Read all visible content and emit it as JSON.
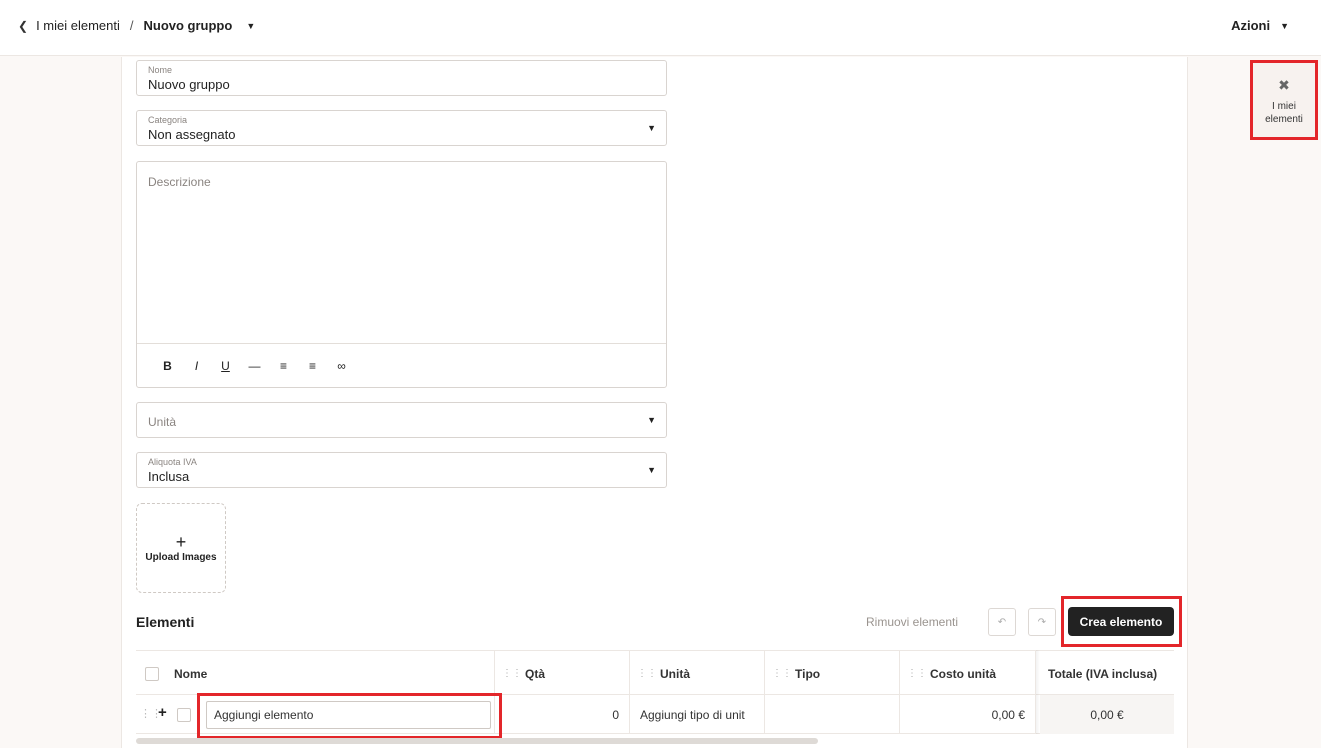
{
  "header": {
    "back_icon": "chevron-left-icon",
    "breadcrumb_parent": "I miei elementi",
    "breadcrumb_separator": "/",
    "breadcrumb_current": "Nuovo gruppo",
    "actions_label": "Azioni"
  },
  "rail": {
    "icon": "tools-icon",
    "label": "I miei elementi"
  },
  "form": {
    "name": {
      "label": "Nome",
      "value": "Nuovo gruppo"
    },
    "category": {
      "label": "Categoria",
      "value": "Non assegnato"
    },
    "description": {
      "placeholder": "Descrizione"
    },
    "toolbar": [
      "bold-icon",
      "italic-icon",
      "underline-icon",
      "horizontal-rule-icon",
      "bullet-list-icon",
      "numbered-list-icon",
      "link-icon"
    ],
    "unit": {
      "placeholder": "Unità"
    },
    "vat": {
      "label": "Aliquota IVA",
      "value": "Inclusa"
    },
    "upload": {
      "plus": "+",
      "label": "Upload Images"
    }
  },
  "elements": {
    "title": "Elementi",
    "remove_label": "Rimuovi elementi",
    "create_label": "Crea elemento",
    "columns": [
      "Nome",
      "Qtà",
      "Unità",
      "Tipo",
      "Costo unità",
      "Totale (IVA inclusa)"
    ],
    "row": {
      "name_value": "Aggiungi elemento",
      "qty": "0",
      "unit": "Aggiungi tipo di unit",
      "type": "",
      "unit_cost": "0,00 €",
      "total": "0,00 €"
    }
  },
  "colors": {
    "accent_dark": "#222222",
    "highlight": "#e3262a"
  }
}
